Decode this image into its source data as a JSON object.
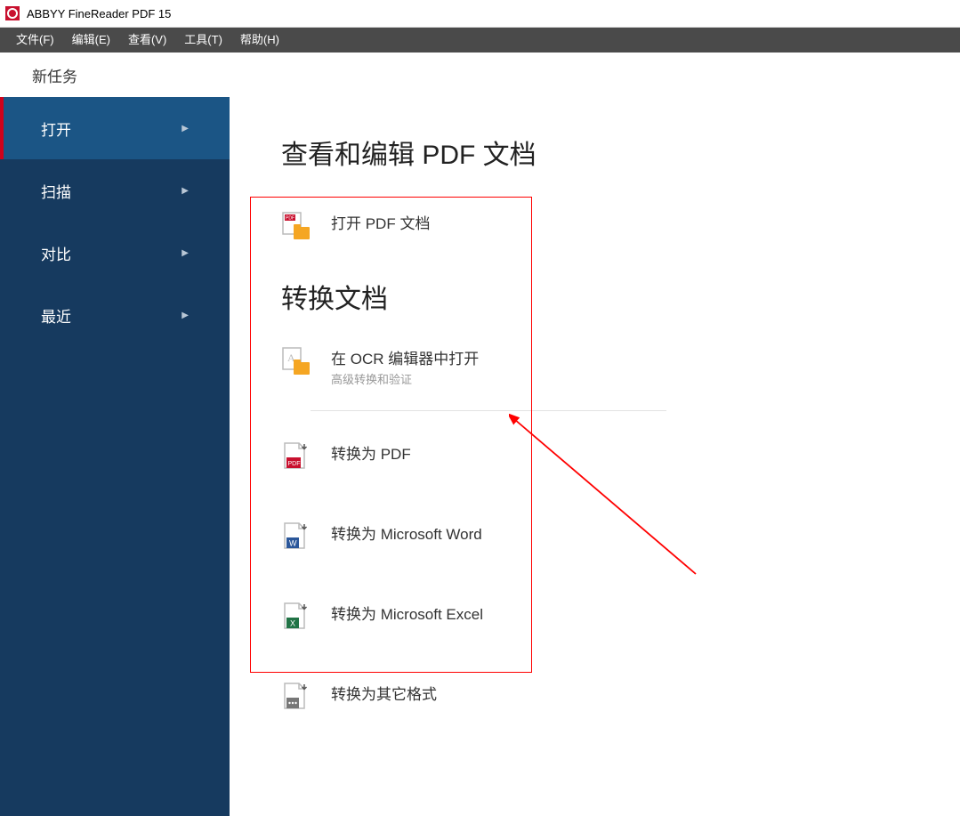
{
  "titlebar": {
    "title": "ABBYY FineReader PDF 15"
  },
  "menu": {
    "file": "文件(F)",
    "edit": "编辑(E)",
    "view": "查看(V)",
    "tools": "工具(T)",
    "help": "帮助(H)"
  },
  "subheader": "新任务",
  "sidebar": {
    "open": "打开",
    "scan": "扫描",
    "compare": "对比",
    "recent": "最近"
  },
  "main": {
    "heading_view_edit": "查看和编辑 PDF 文档",
    "open_pdf": "打开 PDF 文档",
    "heading_convert": "转换文档",
    "open_in_ocr": "在 OCR 编辑器中打开",
    "open_in_ocr_sub": "高级转换和验证",
    "to_pdf": "转换为 PDF",
    "to_word": "转换为 Microsoft Word",
    "to_excel": "转换为 Microsoft Excel",
    "to_other": "转换为其它格式"
  }
}
